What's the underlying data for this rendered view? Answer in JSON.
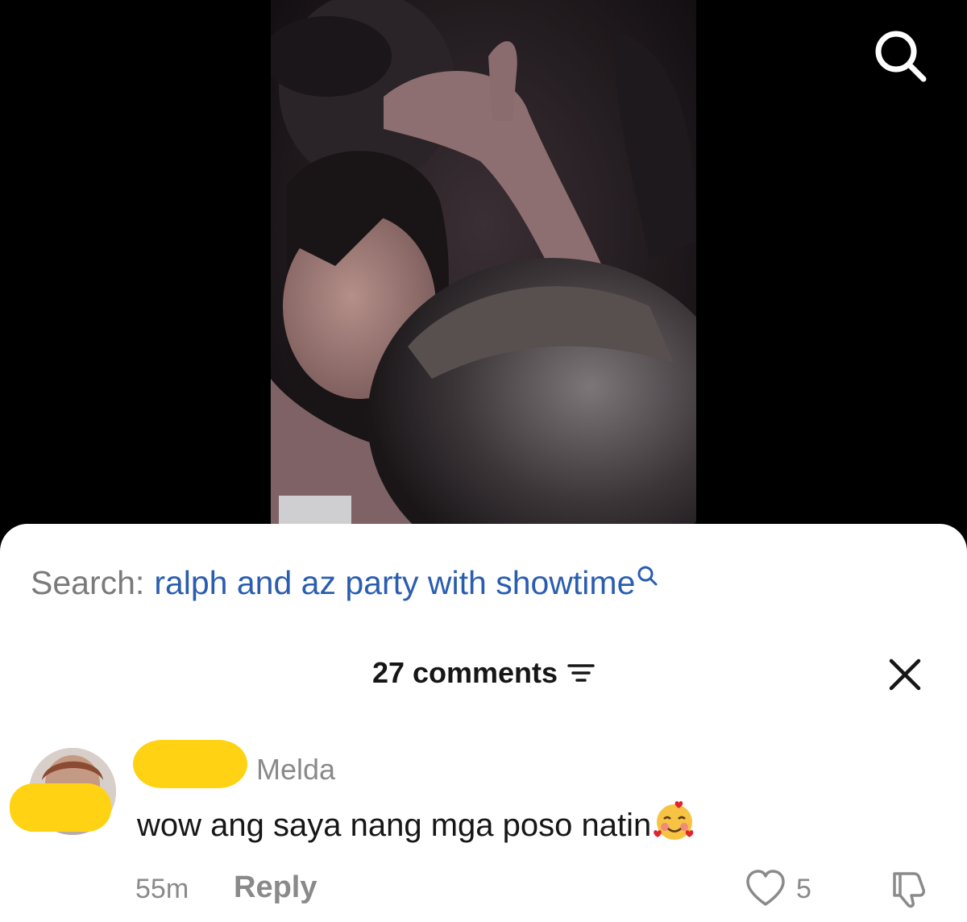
{
  "video": {
    "search_icon": "search-icon"
  },
  "sheet": {
    "search_prefix": "Search:",
    "search_query": "ralph and az party with showtime",
    "search_icon": "search-icon",
    "comments_count_label": "27 comments",
    "filter_icon": "sort-filter-icon",
    "close_icon": "close-icon"
  },
  "comment": {
    "username": "Melda",
    "text": "wow ang saya nang mga poso natin",
    "emoji": "🥰",
    "time": "55m",
    "reply_label": "Reply",
    "like_count": "5",
    "like_icon": "heart-icon",
    "dislike_icon": "thumbs-down-icon",
    "redaction_color": "#ffd313"
  },
  "colors": {
    "query_link": "#2a5db0",
    "muted_text": "#8a8a8a",
    "sheet_bg": "#ffffff",
    "video_bg": "#000000"
  }
}
